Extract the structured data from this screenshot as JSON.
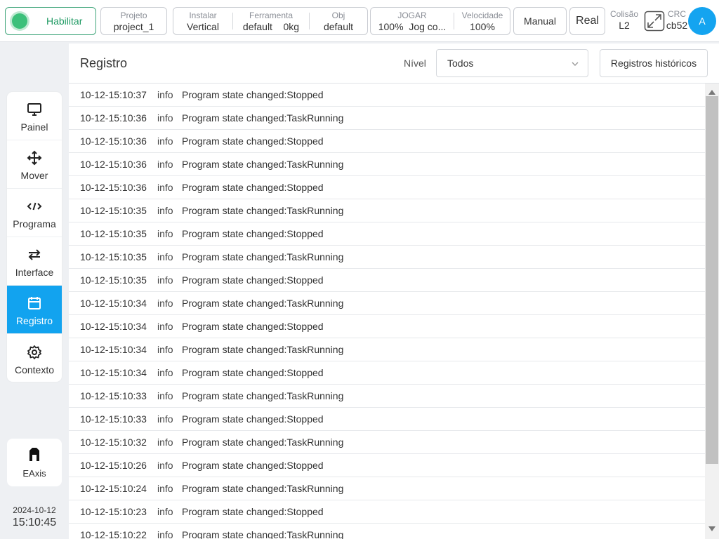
{
  "header": {
    "enable_label": "Habilitar",
    "project": {
      "caption": "Projeto",
      "value": "project_1"
    },
    "install": {
      "caption": "Instalar",
      "value": "Vertical"
    },
    "tool": {
      "caption": "Ferramenta",
      "value": "default",
      "payload": "0kg"
    },
    "obj": {
      "caption": "Obj",
      "value": "default"
    },
    "jog": {
      "caption": "JOGAR",
      "percent": "100%",
      "mode": "Jog co..."
    },
    "speed": {
      "caption": "Velocidade",
      "value": "100%"
    },
    "manual_label": "Manual",
    "real_label": "Real",
    "collision": {
      "caption": "Colisão",
      "value": "L2"
    },
    "crc": {
      "caption": "CRC",
      "value": "cb52"
    },
    "avatar_letter": "A"
  },
  "sidebar": {
    "items": [
      {
        "label": "Painel",
        "icon": "monitor-icon"
      },
      {
        "label": "Mover",
        "icon": "move-arrows-icon"
      },
      {
        "label": "Programa",
        "icon": "code-icon"
      },
      {
        "label": "Interface",
        "icon": "swap-arrows-icon"
      },
      {
        "label": "Registro",
        "icon": "calendar-icon"
      },
      {
        "label": "Contexto",
        "icon": "gear-icon"
      }
    ],
    "active_index": 4,
    "eaxis_label": "EAxis",
    "date": "2024-10-12",
    "time": "15:10:45"
  },
  "main": {
    "title": "Registro",
    "level_label": "Nível",
    "level_value": "Todos",
    "history_button": "Registros históricos",
    "logs": [
      {
        "time": "10-12-15:10:37",
        "level": "info",
        "message": "Program state changed:Stopped"
      },
      {
        "time": "10-12-15:10:36",
        "level": "info",
        "message": "Program state changed:TaskRunning"
      },
      {
        "time": "10-12-15:10:36",
        "level": "info",
        "message": "Program state changed:Stopped"
      },
      {
        "time": "10-12-15:10:36",
        "level": "info",
        "message": "Program state changed:TaskRunning"
      },
      {
        "time": "10-12-15:10:36",
        "level": "info",
        "message": "Program state changed:Stopped"
      },
      {
        "time": "10-12-15:10:35",
        "level": "info",
        "message": "Program state changed:TaskRunning"
      },
      {
        "time": "10-12-15:10:35",
        "level": "info",
        "message": "Program state changed:Stopped"
      },
      {
        "time": "10-12-15:10:35",
        "level": "info",
        "message": "Program state changed:TaskRunning"
      },
      {
        "time": "10-12-15:10:35",
        "level": "info",
        "message": "Program state changed:Stopped"
      },
      {
        "time": "10-12-15:10:34",
        "level": "info",
        "message": "Program state changed:TaskRunning"
      },
      {
        "time": "10-12-15:10:34",
        "level": "info",
        "message": "Program state changed:Stopped"
      },
      {
        "time": "10-12-15:10:34",
        "level": "info",
        "message": "Program state changed:TaskRunning"
      },
      {
        "time": "10-12-15:10:34",
        "level": "info",
        "message": "Program state changed:Stopped"
      },
      {
        "time": "10-12-15:10:33",
        "level": "info",
        "message": "Program state changed:TaskRunning"
      },
      {
        "time": "10-12-15:10:33",
        "level": "info",
        "message": "Program state changed:Stopped"
      },
      {
        "time": "10-12-15:10:32",
        "level": "info",
        "message": "Program state changed:TaskRunning"
      },
      {
        "time": "10-12-15:10:26",
        "level": "info",
        "message": "Program state changed:Stopped"
      },
      {
        "time": "10-12-15:10:24",
        "level": "info",
        "message": "Program state changed:TaskRunning"
      },
      {
        "time": "10-12-15:10:23",
        "level": "info",
        "message": "Program state changed:Stopped"
      },
      {
        "time": "10-12-15:10:22",
        "level": "info",
        "message": "Program state changed:TaskRunning"
      }
    ]
  },
  "colors": {
    "accent": "#12a3ef",
    "enable_green": "#3cc07a"
  }
}
